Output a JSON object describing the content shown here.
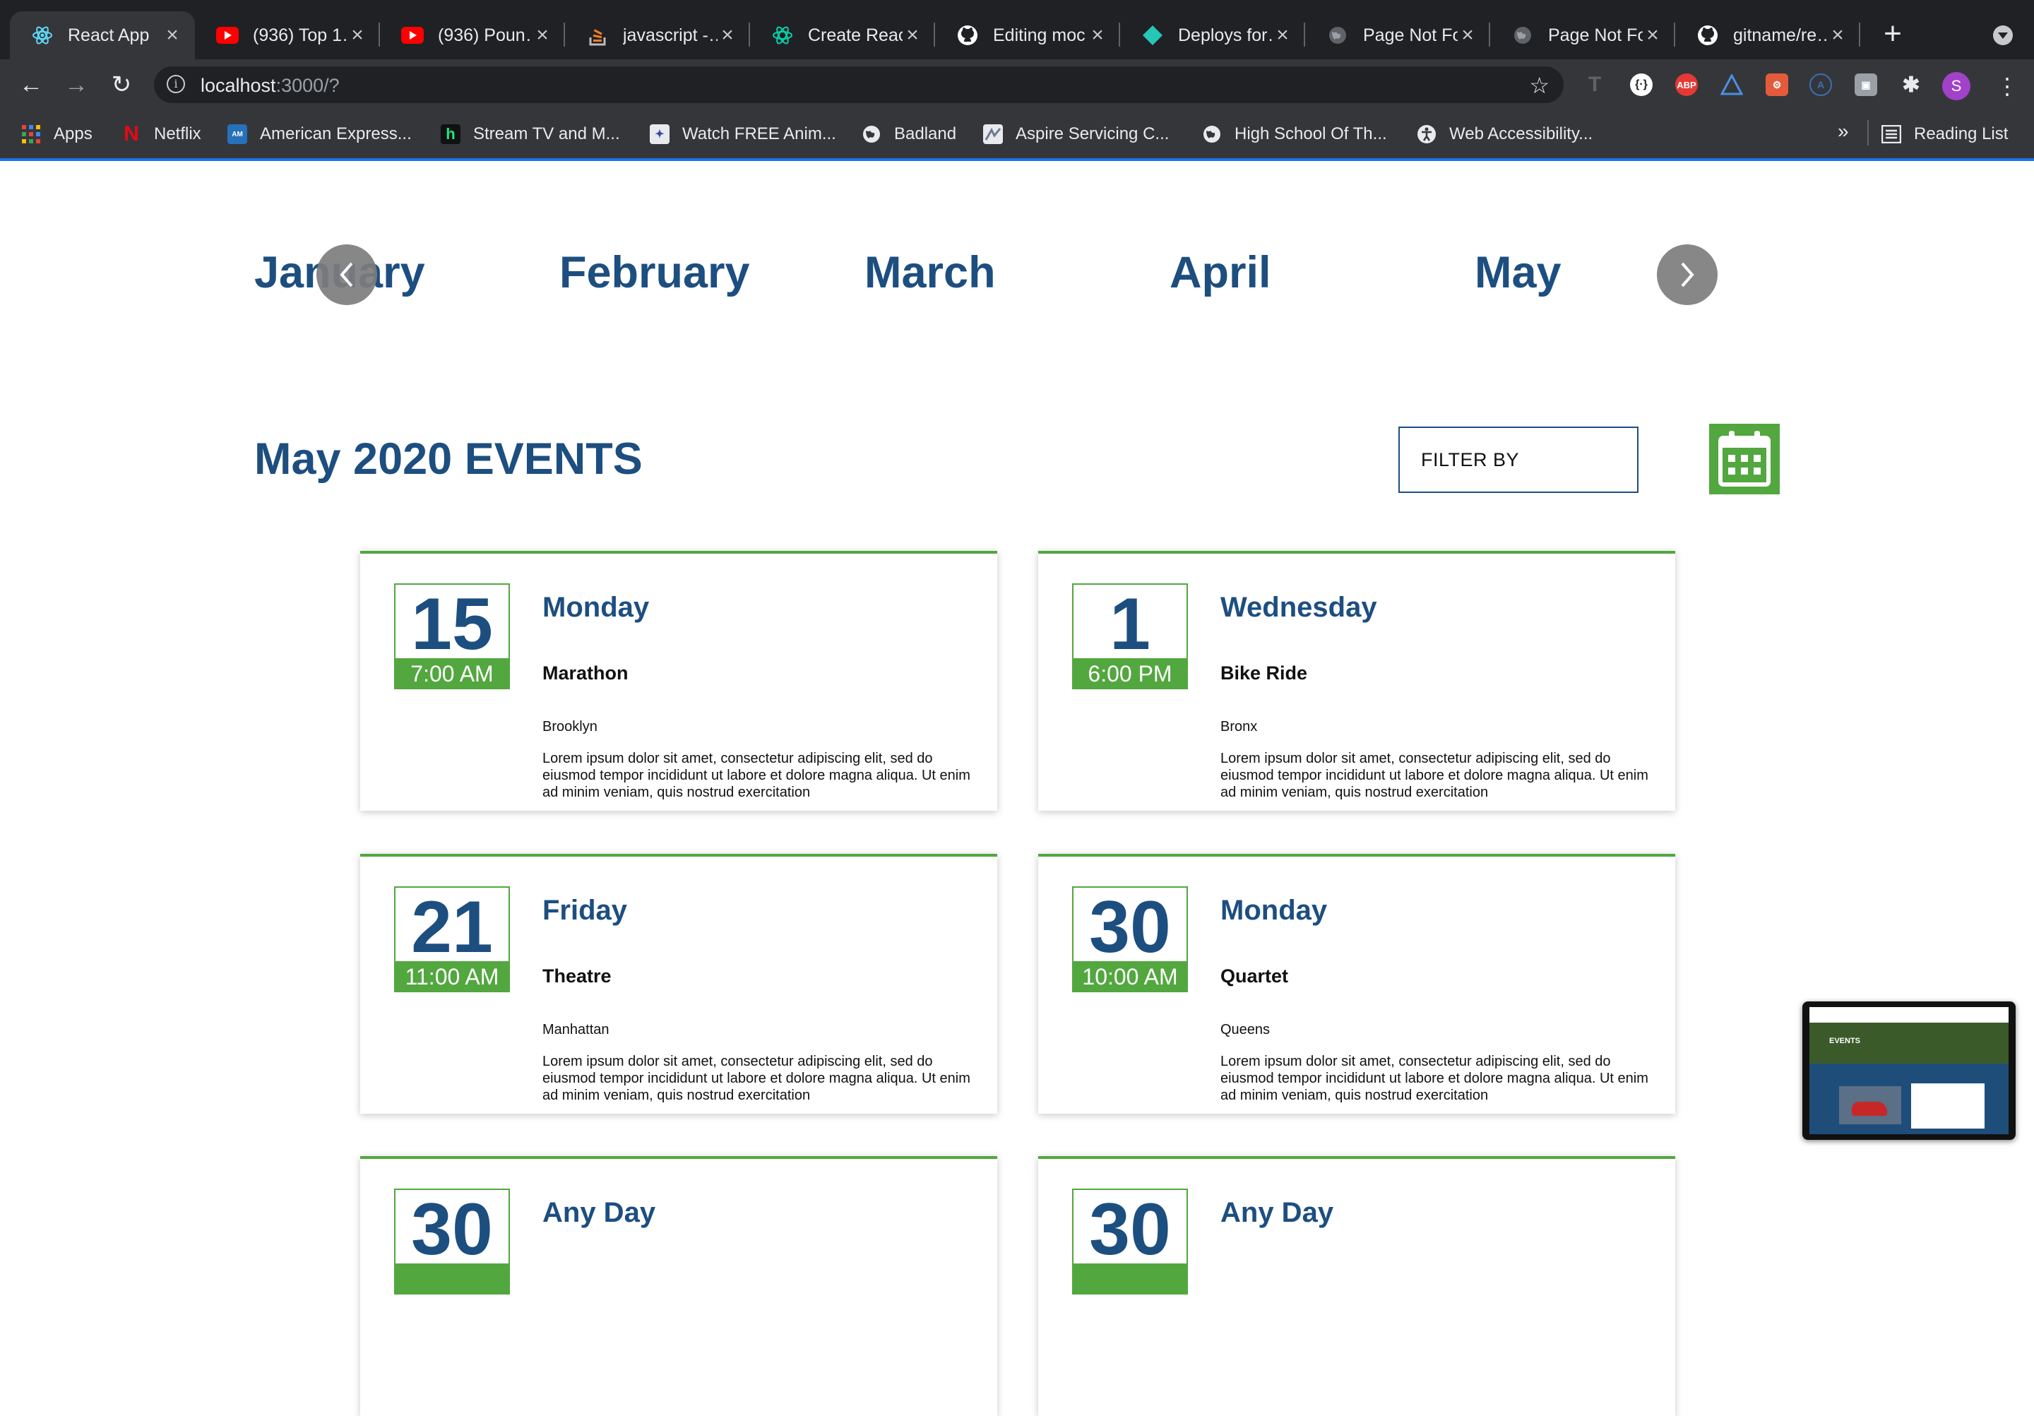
{
  "browser": {
    "tabs": [
      {
        "label": "React App",
        "icon": "react-icon",
        "active": true
      },
      {
        "label": "(936) Top 1…",
        "icon": "youtube-icon"
      },
      {
        "label": "(936) Poun…",
        "icon": "youtube-icon"
      },
      {
        "label": "javascript -…",
        "icon": "stackoverflow-icon"
      },
      {
        "label": "Create Reac…",
        "icon": "react-icon"
      },
      {
        "label": "Editing moc…",
        "icon": "github-icon"
      },
      {
        "label": "Deploys for…",
        "icon": "netlify-icon"
      },
      {
        "label": "Page Not Fo…",
        "icon": "globe-icon"
      },
      {
        "label": "Page Not Fo…",
        "icon": "globe-icon"
      },
      {
        "label": "gitname/re…",
        "icon": "github-icon"
      }
    ],
    "url_host": "localhost",
    "url_rest": ":3000/?",
    "profile_initial": "S",
    "bookmarks": [
      {
        "label": "Apps",
        "icon": "apps-grid-icon"
      },
      {
        "label": "Netflix",
        "icon": "netflix-icon"
      },
      {
        "label": "American Express...",
        "icon": "amex-icon"
      },
      {
        "label": "Stream TV and M...",
        "icon": "hulu-icon"
      },
      {
        "label": "Watch FREE Anim...",
        "icon": "anime-icon"
      },
      {
        "label": "Badland",
        "icon": "globe-icon"
      },
      {
        "label": "Aspire Servicing C...",
        "icon": "aspire-icon"
      },
      {
        "label": "High School Of Th...",
        "icon": "globe-icon"
      },
      {
        "label": "Web Accessibility...",
        "icon": "accessibility-icon"
      }
    ],
    "more_bookmarks": "»",
    "reading_list": "Reading List",
    "extensions": [
      "ABP"
    ]
  },
  "months": [
    "January",
    "February",
    "March",
    "April",
    "May"
  ],
  "events_title": "May 2020 EVENTS",
  "filter_label": "FILTER BY",
  "events": [
    {
      "day": "15",
      "time": "7:00 AM",
      "weekday": "Monday",
      "name": "Marathon",
      "location": "Brooklyn",
      "description": "Lorem ipsum dolor sit amet, consectetur adipiscing elit, sed do eiusmod tempor incididunt ut labore et dolore magna aliqua. Ut enim ad minim veniam, quis nostrud exercitation"
    },
    {
      "day": "1",
      "time": "6:00 PM",
      "weekday": "Wednesday",
      "name": "Bike Ride",
      "location": "Bronx",
      "description": "Lorem ipsum dolor sit amet, consectetur adipiscing elit, sed do eiusmod tempor incididunt ut labore et dolore magna aliqua. Ut enim ad minim veniam, quis nostrud exercitation"
    },
    {
      "day": "21",
      "time": "11:00 AM",
      "weekday": "Friday",
      "name": "Theatre",
      "location": "Manhattan",
      "description": "Lorem ipsum dolor sit amet, consectetur adipiscing elit, sed do eiusmod tempor incididunt ut labore et dolore magna aliqua. Ut enim ad minim veniam, quis nostrud exercitation"
    },
    {
      "day": "30",
      "time": "10:00 AM",
      "weekday": "Monday",
      "name": "Quartet",
      "location": "Queens",
      "description": "Lorem ipsum dolor sit amet, consectetur adipiscing elit, sed do eiusmod tempor incididunt ut labore et dolore magna aliqua. Ut enim ad minim veniam, quis nostrud exercitation"
    },
    {
      "day": "30",
      "weekday": "Any Day"
    },
    {
      "day": "30",
      "weekday": "Any Day"
    }
  ],
  "pip_preview": {
    "label": "EVENTS"
  },
  "colors": {
    "brand_blue": "#1d4e80",
    "accent_green": "#52a73f",
    "arrow_gray": "#7d7d7d"
  }
}
